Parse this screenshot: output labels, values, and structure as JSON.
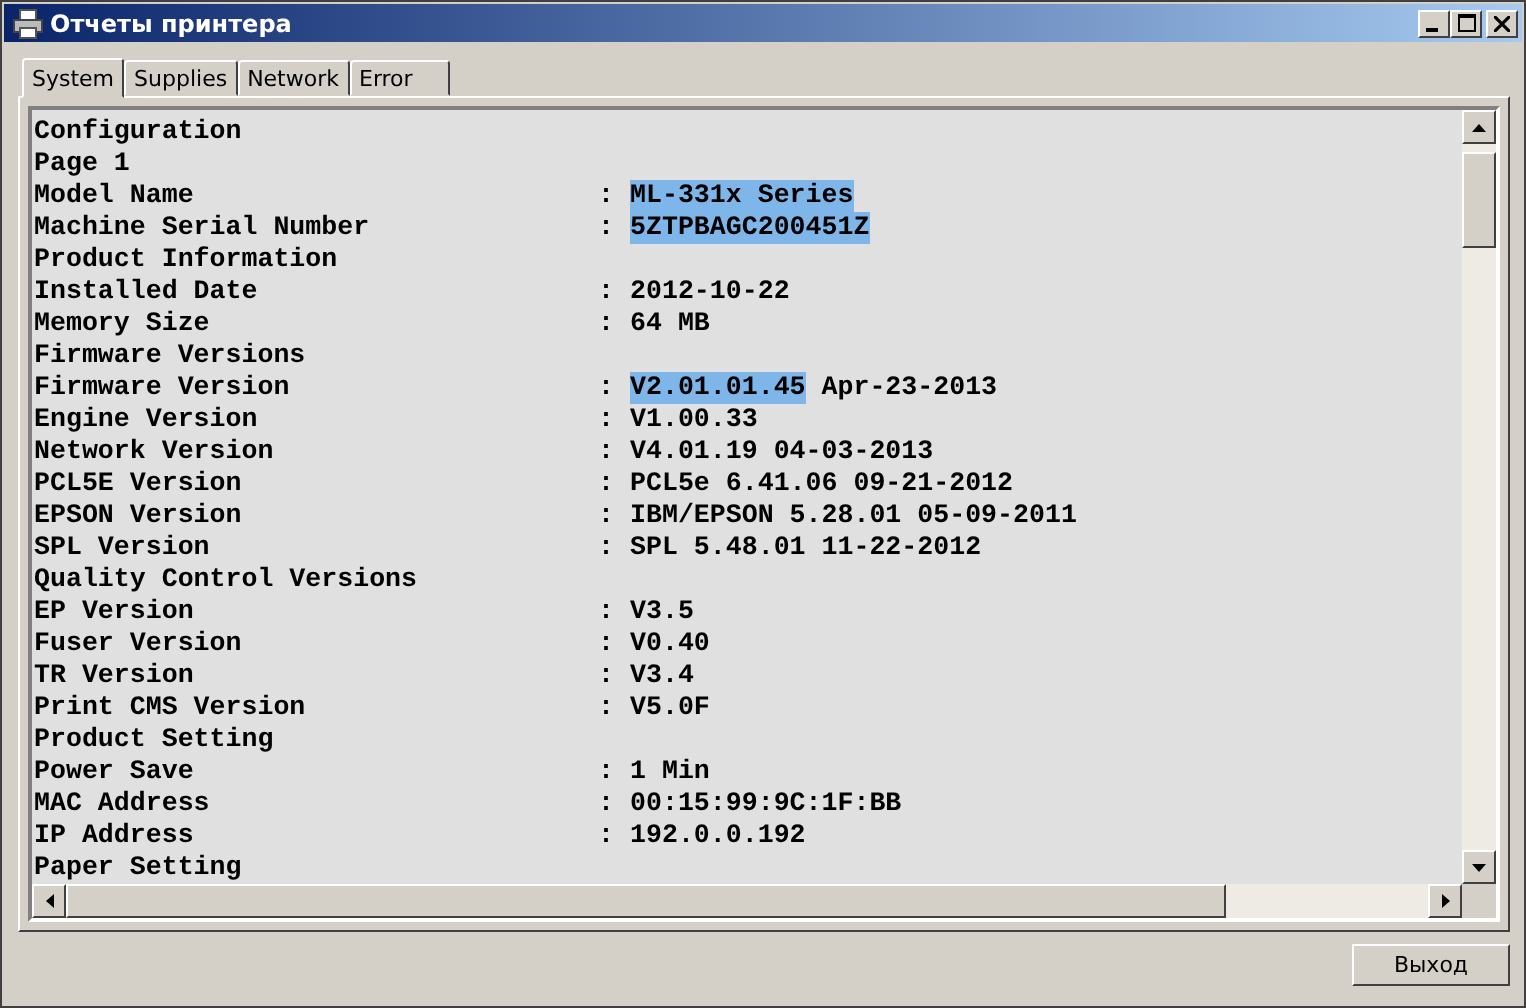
{
  "window": {
    "title": "Отчеты принтера"
  },
  "tabs": [
    {
      "label": "System",
      "selected": true
    },
    {
      "label": "Supplies",
      "selected": false
    },
    {
      "label": "Network",
      "selected": false
    },
    {
      "label": "Error",
      "selected": false
    }
  ],
  "report": {
    "lines": [
      {
        "label": "Configuration"
      },
      {
        "label": "Page 1"
      },
      {
        "label": "Model Name",
        "colon": ":",
        "value": [
          {
            "text": "ML-331x Series",
            "selected": true
          }
        ]
      },
      {
        "label": "Machine Serial Number",
        "colon": ":",
        "value": [
          {
            "text": "5ZTPBAGC200451Z",
            "selected": true
          }
        ]
      },
      {
        "label": "Product Information"
      },
      {
        "label": "Installed Date",
        "colon": ":",
        "value": [
          {
            "text": "2012-10-22",
            "selected": false
          }
        ]
      },
      {
        "label": "Memory Size",
        "colon": ":",
        "value": [
          {
            "text": "64 MB",
            "selected": false
          }
        ]
      },
      {
        "label": "Firmware Versions"
      },
      {
        "label": "Firmware Version",
        "colon": ":",
        "value": [
          {
            "text": "V2.01.01.45",
            "selected": true
          },
          {
            "text": " Apr-23-2013",
            "selected": false
          }
        ]
      },
      {
        "label": "Engine Version",
        "colon": ":",
        "value": [
          {
            "text": "V1.00.33",
            "selected": false
          }
        ]
      },
      {
        "label": "Network Version",
        "colon": ":",
        "value": [
          {
            "text": "V4.01.19 04-03-2013",
            "selected": false
          }
        ]
      },
      {
        "label": "PCL5E Version",
        "colon": ":",
        "value": [
          {
            "text": "PCL5e 6.41.06 09-21-2012",
            "selected": false
          }
        ]
      },
      {
        "label": "EPSON Version",
        "colon": ":",
        "value": [
          {
            "text": "IBM/EPSON 5.28.01 05-09-2011",
            "selected": false
          }
        ]
      },
      {
        "label": "SPL Version",
        "colon": ":",
        "value": [
          {
            "text": "SPL 5.48.01 11-22-2012",
            "selected": false
          }
        ]
      },
      {
        "label": "Quality Control Versions"
      },
      {
        "label": "EP Version",
        "colon": ":",
        "value": [
          {
            "text": "V3.5",
            "selected": false
          }
        ]
      },
      {
        "label": "Fuser Version",
        "colon": ":",
        "value": [
          {
            "text": "V0.40",
            "selected": false
          }
        ]
      },
      {
        "label": "TR Version",
        "colon": ":",
        "value": [
          {
            "text": "V3.4",
            "selected": false
          }
        ]
      },
      {
        "label": "Print CMS Version",
        "colon": ":",
        "value": [
          {
            "text": "V5.0F",
            "selected": false
          }
        ]
      },
      {
        "label": "Product Setting"
      },
      {
        "label": "Power Save",
        "colon": ":",
        "value": [
          {
            "text": "1 Min",
            "selected": false
          }
        ]
      },
      {
        "label": "MAC Address",
        "colon": ":",
        "value": [
          {
            "text": "00:15:99:9C:1F:BB",
            "selected": false
          }
        ]
      },
      {
        "label": "IP Address",
        "colon": ":",
        "value": [
          {
            "text": "192.0.0.192",
            "selected": false
          }
        ]
      },
      {
        "label": "Paper Setting"
      }
    ]
  },
  "buttons": [
    {
      "label": "Выход"
    }
  ]
}
